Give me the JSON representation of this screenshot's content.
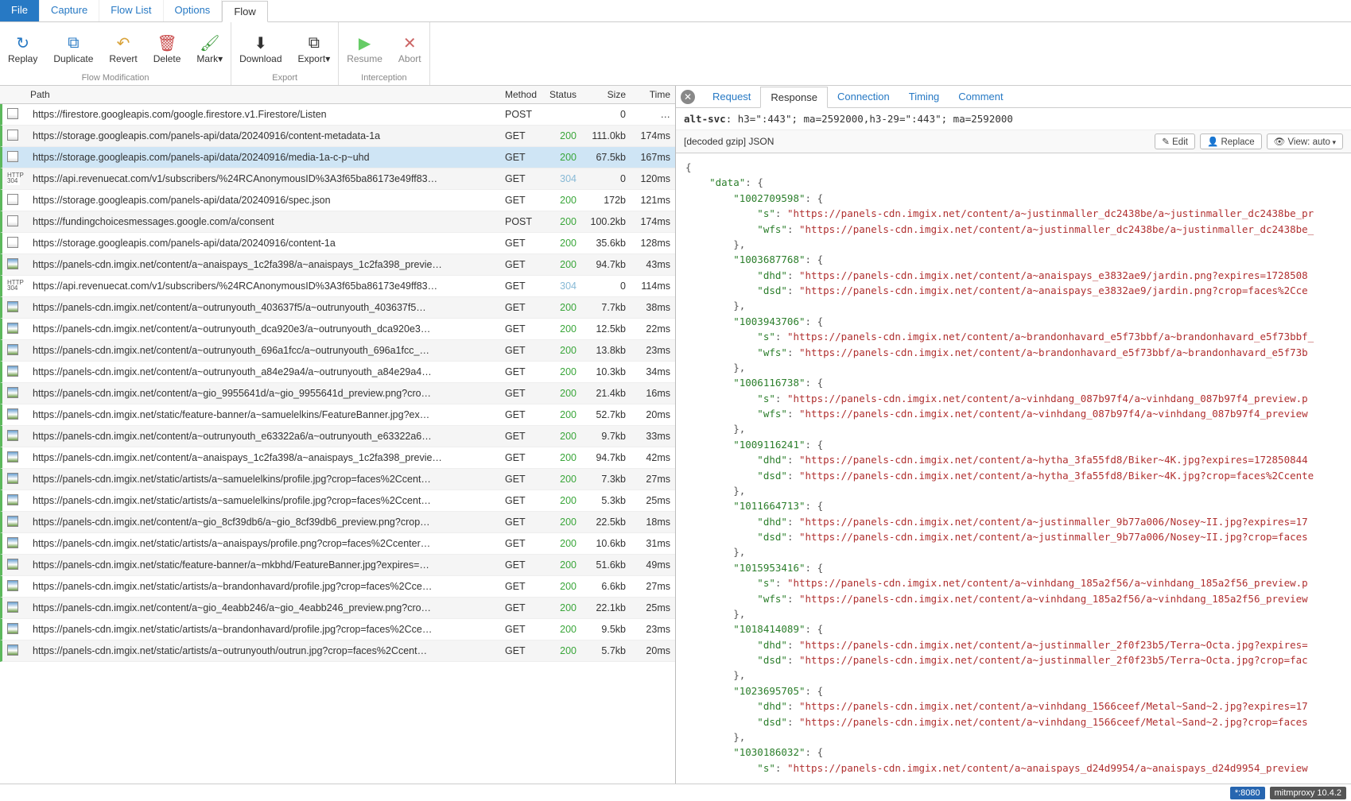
{
  "menubar": {
    "file": "File",
    "capture": "Capture",
    "flowlist": "Flow List",
    "options": "Options",
    "flow": "Flow"
  },
  "ribbon": {
    "replay": "Replay",
    "duplicate": "Duplicate",
    "revert": "Revert",
    "delete": "Delete",
    "mark": "Mark",
    "download": "Download",
    "export": "Export",
    "resume": "Resume",
    "abort": "Abort",
    "group_flow": "Flow Modification",
    "group_export": "Export",
    "group_intercept": "Interception"
  },
  "columns": {
    "path": "Path",
    "method": "Method",
    "status": "Status",
    "size": "Size",
    "time": "Time"
  },
  "flows": [
    {
      "icon": "doc",
      "path": "https://firestore.googleapis.com/google.firestore.v1.Firestore/Listen",
      "method": "POST",
      "status": "",
      "size": "0",
      "time": "…"
    },
    {
      "icon": "doc",
      "path": "https://storage.googleapis.com/panels-api/data/20240916/content-metadata-1a",
      "method": "GET",
      "status": "200",
      "size": "111.0kb",
      "time": "174ms"
    },
    {
      "icon": "doc",
      "path": "https://storage.googleapis.com/panels-api/data/20240916/media-1a-c-p~uhd",
      "method": "GET",
      "status": "200",
      "size": "67.5kb",
      "time": "167ms",
      "sel": true
    },
    {
      "icon": "304",
      "path": "https://api.revenuecat.com/v1/subscribers/%24RCAnonymousID%3A3f65ba86173e49ff83…",
      "method": "GET",
      "status": "304",
      "size": "0",
      "time": "120ms"
    },
    {
      "icon": "doc",
      "path": "https://storage.googleapis.com/panels-api/data/20240916/spec.json",
      "method": "GET",
      "status": "200",
      "size": "172b",
      "time": "121ms"
    },
    {
      "icon": "doc",
      "path": "https://fundingchoicesmessages.google.com/a/consent",
      "method": "POST",
      "status": "200",
      "size": "100.2kb",
      "time": "174ms"
    },
    {
      "icon": "doc",
      "path": "https://storage.googleapis.com/panels-api/data/20240916/content-1a",
      "method": "GET",
      "status": "200",
      "size": "35.6kb",
      "time": "128ms"
    },
    {
      "icon": "img",
      "path": "https://panels-cdn.imgix.net/content/a~anaispays_1c2fa398/a~anaispays_1c2fa398_previe…",
      "method": "GET",
      "status": "200",
      "size": "94.7kb",
      "time": "43ms"
    },
    {
      "icon": "304",
      "path": "https://api.revenuecat.com/v1/subscribers/%24RCAnonymousID%3A3f65ba86173e49ff83…",
      "method": "GET",
      "status": "304",
      "size": "0",
      "time": "114ms"
    },
    {
      "icon": "img",
      "path": "https://panels-cdn.imgix.net/content/a~outrunyouth_403637f5/a~outrunyouth_403637f5…",
      "method": "GET",
      "status": "200",
      "size": "7.7kb",
      "time": "38ms"
    },
    {
      "icon": "img",
      "path": "https://panels-cdn.imgix.net/content/a~outrunyouth_dca920e3/a~outrunyouth_dca920e3…",
      "method": "GET",
      "status": "200",
      "size": "12.5kb",
      "time": "22ms"
    },
    {
      "icon": "img",
      "path": "https://panels-cdn.imgix.net/content/a~outrunyouth_696a1fcc/a~outrunyouth_696a1fcc_…",
      "method": "GET",
      "status": "200",
      "size": "13.8kb",
      "time": "23ms"
    },
    {
      "icon": "img",
      "path": "https://panels-cdn.imgix.net/content/a~outrunyouth_a84e29a4/a~outrunyouth_a84e29a4…",
      "method": "GET",
      "status": "200",
      "size": "10.3kb",
      "time": "34ms"
    },
    {
      "icon": "img",
      "path": "https://panels-cdn.imgix.net/content/a~gio_9955641d/a~gio_9955641d_preview.png?cro…",
      "method": "GET",
      "status": "200",
      "size": "21.4kb",
      "time": "16ms"
    },
    {
      "icon": "img",
      "path": "https://panels-cdn.imgix.net/static/feature-banner/a~samuelelkins/FeatureBanner.jpg?ex…",
      "method": "GET",
      "status": "200",
      "size": "52.7kb",
      "time": "20ms"
    },
    {
      "icon": "img",
      "path": "https://panels-cdn.imgix.net/content/a~outrunyouth_e63322a6/a~outrunyouth_e63322a6…",
      "method": "GET",
      "status": "200",
      "size": "9.7kb",
      "time": "33ms"
    },
    {
      "icon": "img",
      "path": "https://panels-cdn.imgix.net/content/a~anaispays_1c2fa398/a~anaispays_1c2fa398_previe…",
      "method": "GET",
      "status": "200",
      "size": "94.7kb",
      "time": "42ms"
    },
    {
      "icon": "img",
      "path": "https://panels-cdn.imgix.net/static/artists/a~samuelelkins/profile.jpg?crop=faces%2Ccent…",
      "method": "GET",
      "status": "200",
      "size": "7.3kb",
      "time": "27ms"
    },
    {
      "icon": "img",
      "path": "https://panels-cdn.imgix.net/static/artists/a~samuelelkins/profile.jpg?crop=faces%2Ccent…",
      "method": "GET",
      "status": "200",
      "size": "5.3kb",
      "time": "25ms"
    },
    {
      "icon": "img",
      "path": "https://panels-cdn.imgix.net/content/a~gio_8cf39db6/a~gio_8cf39db6_preview.png?crop…",
      "method": "GET",
      "status": "200",
      "size": "22.5kb",
      "time": "18ms"
    },
    {
      "icon": "img",
      "path": "https://panels-cdn.imgix.net/static/artists/a~anaispays/profile.png?crop=faces%2Ccenter…",
      "method": "GET",
      "status": "200",
      "size": "10.6kb",
      "time": "31ms"
    },
    {
      "icon": "img",
      "path": "https://panels-cdn.imgix.net/static/feature-banner/a~mkbhd/FeatureBanner.jpg?expires=…",
      "method": "GET",
      "status": "200",
      "size": "51.6kb",
      "time": "49ms"
    },
    {
      "icon": "img",
      "path": "https://panels-cdn.imgix.net/static/artists/a~brandonhavard/profile.jpg?crop=faces%2Cce…",
      "method": "GET",
      "status": "200",
      "size": "6.6kb",
      "time": "27ms"
    },
    {
      "icon": "img",
      "path": "https://panels-cdn.imgix.net/content/a~gio_4eabb246/a~gio_4eabb246_preview.png?cro…",
      "method": "GET",
      "status": "200",
      "size": "22.1kb",
      "time": "25ms"
    },
    {
      "icon": "img",
      "path": "https://panels-cdn.imgix.net/static/artists/a~brandonhavard/profile.jpg?crop=faces%2Cce…",
      "method": "GET",
      "status": "200",
      "size": "9.5kb",
      "time": "23ms"
    },
    {
      "icon": "img",
      "path": "https://panels-cdn.imgix.net/static/artists/a~outrunyouth/outrun.jpg?crop=faces%2Ccent…",
      "method": "GET",
      "status": "200",
      "size": "5.7kb",
      "time": "20ms"
    }
  ],
  "detail": {
    "tabs": {
      "request": "Request",
      "response": "Response",
      "connection": "Connection",
      "timing": "Timing",
      "comment": "Comment"
    },
    "header_name": "alt-svc",
    "header_value": "h3=\":443\"; ma=2592000,h3-29=\":443\"; ma=2592000",
    "decode_label": "[decoded gzip] JSON",
    "buttons": {
      "edit": "✎ Edit",
      "replace": "👤 Replace",
      "view": "👁 View: auto"
    }
  },
  "json_body": [
    [
      "p",
      "{"
    ],
    [
      "k",
      "    \"data\"",
      ": {"
    ],
    [
      "k",
      "        \"1002709598\"",
      ": {"
    ],
    [
      "kv",
      "            \"s\"",
      "\"https://panels-cdn.imgix.net/content/a~justinmaller_dc2438be/a~justinmaller_dc2438be_pr"
    ],
    [
      "kv",
      "            \"wfs\"",
      "\"https://panels-cdn.imgix.net/content/a~justinmaller_dc2438be/a~justinmaller_dc2438be_"
    ],
    [
      "p",
      "        },"
    ],
    [
      "k",
      "        \"1003687768\"",
      ": {"
    ],
    [
      "kv",
      "            \"dhd\"",
      "\"https://panels-cdn.imgix.net/content/a~anaispays_e3832ae9/jardin.png?expires=1728508"
    ],
    [
      "kv",
      "            \"dsd\"",
      "\"https://panels-cdn.imgix.net/content/a~anaispays_e3832ae9/jardin.png?crop=faces%2Cce"
    ],
    [
      "p",
      "        },"
    ],
    [
      "k",
      "        \"1003943706\"",
      ": {"
    ],
    [
      "kv",
      "            \"s\"",
      "\"https://panels-cdn.imgix.net/content/a~brandonhavard_e5f73bbf/a~brandonhavard_e5f73bbf_"
    ],
    [
      "kv",
      "            \"wfs\"",
      "\"https://panels-cdn.imgix.net/content/a~brandonhavard_e5f73bbf/a~brandonhavard_e5f73b"
    ],
    [
      "p",
      "        },"
    ],
    [
      "k",
      "        \"1006116738\"",
      ": {"
    ],
    [
      "kv",
      "            \"s\"",
      "\"https://panels-cdn.imgix.net/content/a~vinhdang_087b97f4/a~vinhdang_087b97f4_preview.p"
    ],
    [
      "kv",
      "            \"wfs\"",
      "\"https://panels-cdn.imgix.net/content/a~vinhdang_087b97f4/a~vinhdang_087b97f4_preview"
    ],
    [
      "p",
      "        },"
    ],
    [
      "k",
      "        \"1009116241\"",
      ": {"
    ],
    [
      "kv",
      "            \"dhd\"",
      "\"https://panels-cdn.imgix.net/content/a~hytha_3fa55fd8/Biker~4K.jpg?expires=172850844"
    ],
    [
      "kv",
      "            \"dsd\"",
      "\"https://panels-cdn.imgix.net/content/a~hytha_3fa55fd8/Biker~4K.jpg?crop=faces%2Ccente"
    ],
    [
      "p",
      "        },"
    ],
    [
      "k",
      "        \"1011664713\"",
      ": {"
    ],
    [
      "kv",
      "            \"dhd\"",
      "\"https://panels-cdn.imgix.net/content/a~justinmaller_9b77a006/Nosey~II.jpg?expires=17"
    ],
    [
      "kv",
      "            \"dsd\"",
      "\"https://panels-cdn.imgix.net/content/a~justinmaller_9b77a006/Nosey~II.jpg?crop=faces"
    ],
    [
      "p",
      "        },"
    ],
    [
      "k",
      "        \"1015953416\"",
      ": {"
    ],
    [
      "kv",
      "            \"s\"",
      "\"https://panels-cdn.imgix.net/content/a~vinhdang_185a2f56/a~vinhdang_185a2f56_preview.p"
    ],
    [
      "kv",
      "            \"wfs\"",
      "\"https://panels-cdn.imgix.net/content/a~vinhdang_185a2f56/a~vinhdang_185a2f56_preview"
    ],
    [
      "p",
      "        },"
    ],
    [
      "k",
      "        \"1018414089\"",
      ": {"
    ],
    [
      "kv",
      "            \"dhd\"",
      "\"https://panels-cdn.imgix.net/content/a~justinmaller_2f0f23b5/Terra~Octa.jpg?expires="
    ],
    [
      "kv",
      "            \"dsd\"",
      "\"https://panels-cdn.imgix.net/content/a~justinmaller_2f0f23b5/Terra~Octa.jpg?crop=fac"
    ],
    [
      "p",
      "        },"
    ],
    [
      "k",
      "        \"1023695705\"",
      ": {"
    ],
    [
      "kv",
      "            \"dhd\"",
      "\"https://panels-cdn.imgix.net/content/a~vinhdang_1566ceef/Metal~Sand~2.jpg?expires=17"
    ],
    [
      "kv",
      "            \"dsd\"",
      "\"https://panels-cdn.imgix.net/content/a~vinhdang_1566ceef/Metal~Sand~2.jpg?crop=faces"
    ],
    [
      "p",
      "        },"
    ],
    [
      "k",
      "        \"1030186032\"",
      ": {"
    ],
    [
      "kv",
      "            \"s\"",
      "\"https://panels-cdn.imgix.net/content/a~anaispays_d24d9954/a~anaispays_d24d9954_preview"
    ]
  ],
  "statusbar": {
    "proxy": "*:8080",
    "version": "mitmproxy 10.4.2"
  }
}
